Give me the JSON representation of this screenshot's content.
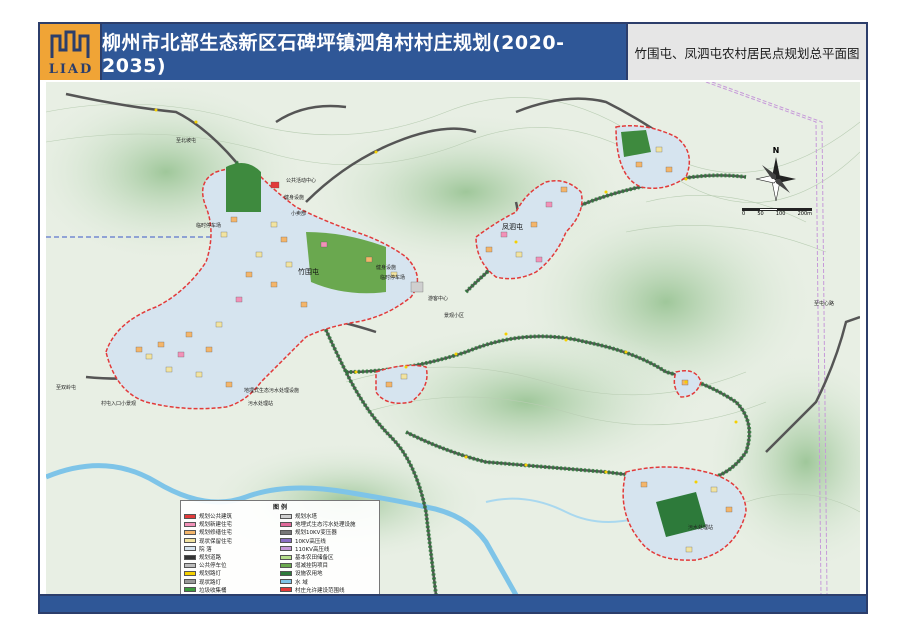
{
  "header": {
    "logo_text": "LIAD",
    "title": "柳州市北部生态新区石碑坪镇泗角村村庄规划(2020-2035)",
    "subtitle": "竹围屯、凤泗屯农村居民点规划总平面图"
  },
  "legend": {
    "title": "图  例",
    "left": [
      {
        "label": "规划公共建筑",
        "color": "#e23a3a"
      },
      {
        "label": "规划新建住宅",
        "color": "#f291b8"
      },
      {
        "label": "规划修缮住宅",
        "color": "#f4b56a"
      },
      {
        "label": "现状保留住宅",
        "color": "#f2e3a0"
      },
      {
        "label": "院   落",
        "color": "#d6e4ef"
      },
      {
        "label": "规划道路",
        "color": "#333333"
      },
      {
        "label": "公共停车位",
        "color": "#bbbbbb"
      },
      {
        "label": "规划路灯",
        "color": "#f5d000"
      },
      {
        "label": "现状路灯",
        "color": "#999999"
      },
      {
        "label": "垃圾收集桶",
        "color": "#3e9a3e"
      }
    ],
    "right": [
      {
        "label": "规划水塔",
        "color": "#cfcfcf"
      },
      {
        "label": "地埋式生态污水处理设施",
        "color": "#e06a9a"
      },
      {
        "label": "规划10KV变压器",
        "color": "#777777"
      },
      {
        "label": "10KV高压线",
        "color": "#8a6fc4"
      },
      {
        "label": "110KV高压线",
        "color": "#c69ad9"
      },
      {
        "label": "基本农田储备区",
        "color": "#b6df8c"
      },
      {
        "label": "增减挂钩项目",
        "color": "#6aa84f"
      },
      {
        "label": "设施农用地",
        "color": "#2d7a3a"
      },
      {
        "label": "水   域",
        "color": "#7ec4e8"
      },
      {
        "label": "村庄允许建设范围线",
        "color": "#e23a3a"
      }
    ]
  },
  "map_labels": {
    "public_center": "公共活动中心",
    "fitness1": "健身设施",
    "parking_west": "临时停车场",
    "shop": "小卖部",
    "parking_mid": "临时停车场",
    "fitness2": "健身设施",
    "tourist": "游客中心",
    "zhuwei": "竹围屯",
    "fengsi": "凤泗屯",
    "pond": "鱼塘",
    "treatment": "地埋式生态污水处理设施",
    "sewage": "污水处理站",
    "scenic": "景观小区",
    "village_road": "乡村道路",
    "entrance_west": "村屯入口小景观",
    "road_west": "至双岭屯",
    "road_north": "至北坡屯",
    "road_east": "至屯心路",
    "sewage_se": "污水处理站",
    "north": "N",
    "scale": [
      "0",
      "50",
      "100",
      "200m"
    ]
  },
  "colors": {
    "title_bar": "#2f5797",
    "logo_bg": "#f0a436",
    "subtitle_bg": "#e6e6e6",
    "boundary": "#e23a3a",
    "road": "#555555",
    "water": "#7ec4e8",
    "terrain": "#c7dcc0"
  }
}
